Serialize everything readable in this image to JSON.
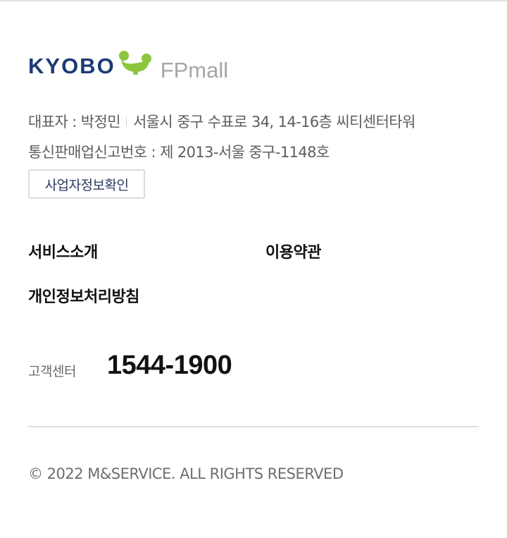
{
  "logo": {
    "brand": "KYOBO",
    "product": "FPmall",
    "colors": {
      "brand": "#1d3b74",
      "bird": "#8cc63f",
      "product": "#a6a6a6"
    },
    "icon": "kyobo-bird-icon"
  },
  "company_info": {
    "ceo": "대표자 : 박정민",
    "address": "서울시 중구 수표로 34, 14-16층 씨티센터타워",
    "registration": "통신판매업신고번호 : 제 2013-서울 중구-1148호",
    "verify_button": "사업자정보확인"
  },
  "links": {
    "service": "서비스소개",
    "terms": "이용약관",
    "privacy": "개인정보처리방침"
  },
  "customer_center": {
    "label": "고객센터",
    "phone": "1544-1900"
  },
  "copyright": "© 2022 M&SERVICE. ALL RIGHTS RESERVED"
}
